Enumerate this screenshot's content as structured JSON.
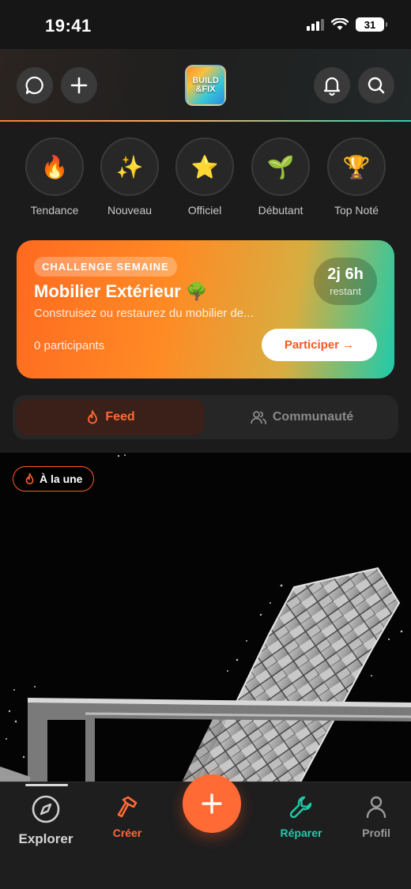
{
  "status": {
    "time": "19:41",
    "battery": "31"
  },
  "header": {
    "logo_line1": "BUILD",
    "logo_line2": "&FIX"
  },
  "categories": [
    {
      "emoji": "🔥",
      "label": "Tendance"
    },
    {
      "emoji": "✨",
      "label": "Nouveau"
    },
    {
      "emoji": "⭐",
      "label": "Officiel"
    },
    {
      "emoji": "🌱",
      "label": "Débutant"
    },
    {
      "emoji": "🏆",
      "label": "Top Noté"
    }
  ],
  "challenge": {
    "badge": "CHALLENGE SEMAINE",
    "title": "Mobilier Extérieur 🌳",
    "description": "Construisez ou restaurez du mobilier de...",
    "time_value": "2j 6h",
    "time_label": "restant",
    "participants": "0 participants",
    "cta": "Participer →"
  },
  "tabs": {
    "feed": "Feed",
    "community": "Communauté"
  },
  "feed": {
    "featured_badge": "À la une"
  },
  "nav": {
    "explorer": "Explorer",
    "create": "Créer",
    "repair": "Réparer",
    "profile": "Profil"
  },
  "colors": {
    "accent": "#ff6a35",
    "teal": "#1ecbaa",
    "background": "#1b1b1b"
  }
}
